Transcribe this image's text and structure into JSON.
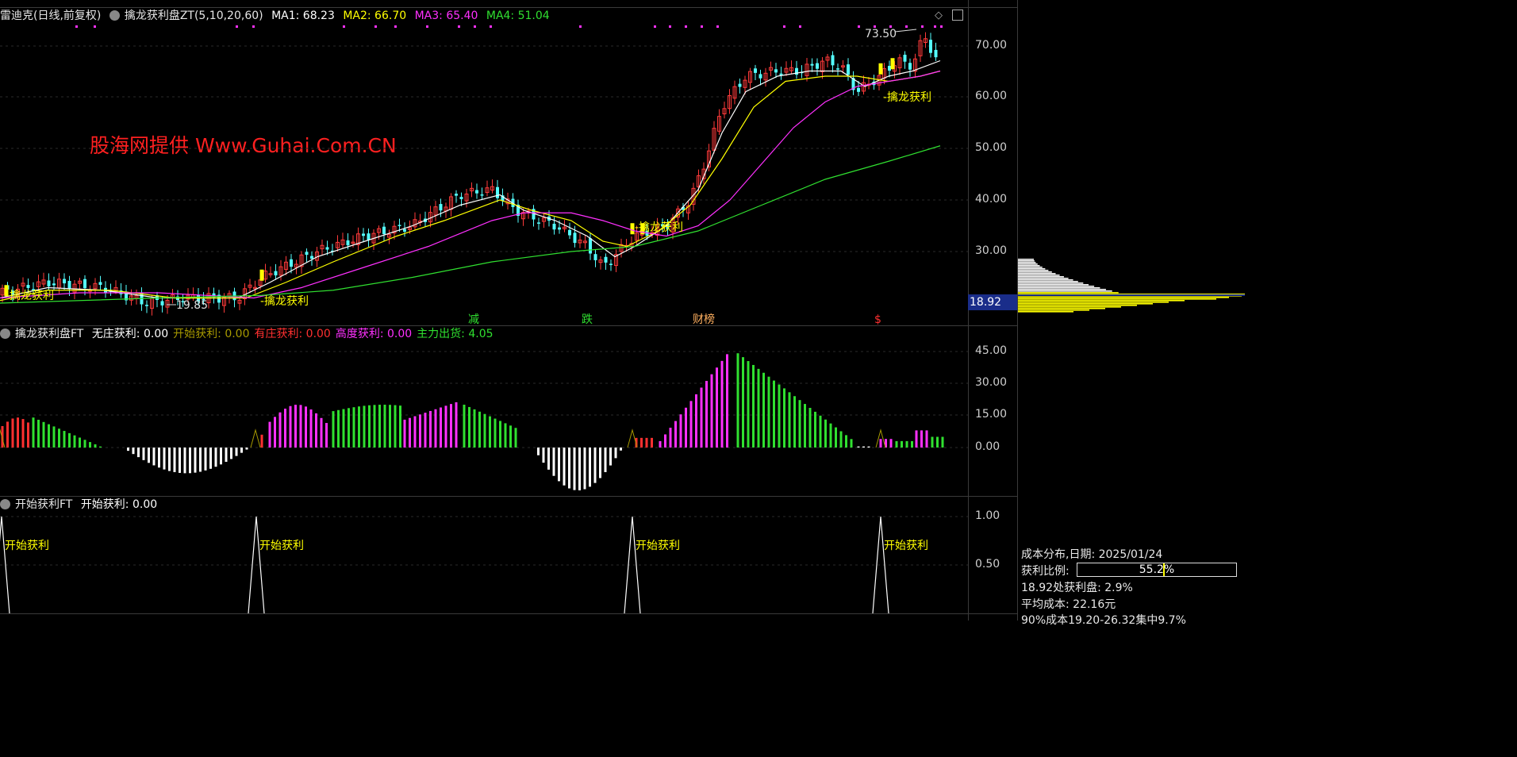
{
  "main_pane": {
    "stock_title": "雷迪克(日线,前复权)",
    "indicator_name": "擒龙获利盘ZT(5,10,20,60)",
    "ma1": "MA1: 68.23",
    "ma2": "MA2: 66.70",
    "ma3": "MA3: 65.40",
    "ma4": "MA4: 51.04",
    "watermark": "股海网提供 Www.Guhai.Com.CN",
    "high_annotation": "73.50",
    "low_annotation": "19.85",
    "signal_label": "擒龙获利",
    "event_markers": [
      "减",
      "跌",
      "财榜",
      "$"
    ],
    "axis_ticks": [
      "70.00",
      "60.00",
      "50.00",
      "40.00",
      "30.00"
    ],
    "price_tag": "18.92"
  },
  "pane2": {
    "name": "擒龙获利盘FT",
    "values": [
      {
        "label": "无庄获利:",
        "value": "0.00",
        "color": "#ffffff"
      },
      {
        "label": "开始获利:",
        "value": "0.00",
        "color": "#a89a00"
      },
      {
        "label": "有庄获利:",
        "value": "0.00",
        "color": "#ff3030"
      },
      {
        "label": "高度获利:",
        "value": "0.00",
        "color": "#ff30ff"
      },
      {
        "label": "主力出货:",
        "value": "4.05",
        "color": "#30e030"
      }
    ],
    "axis_ticks": [
      "45.00",
      "30.00",
      "15.00",
      "0.00"
    ]
  },
  "pane3": {
    "name": "开始获利FT",
    "value_label": "开始获利: 0.00",
    "signal_label": "开始获利",
    "axis_ticks": [
      "1.00",
      "0.50"
    ]
  },
  "side_panel": {
    "title": "成本分布,日期: 2025/01/24",
    "profit_ratio_label": "获利比例:",
    "profit_ratio_value": "55.2%",
    "profit_ratio": 0.552,
    "profit_at_price": "18.92处获利盘: 2.9%",
    "avg_cost": "平均成本: 22.16元",
    "concentration": "90%成本19.20-26.32集中9.7%"
  },
  "colors": {
    "up": "#ff3a3a",
    "down": "#54ffff",
    "ma1": "#ffffff",
    "ma2": "#ffff00",
    "ma3": "#ff30ff",
    "ma4": "#30e030"
  }
}
